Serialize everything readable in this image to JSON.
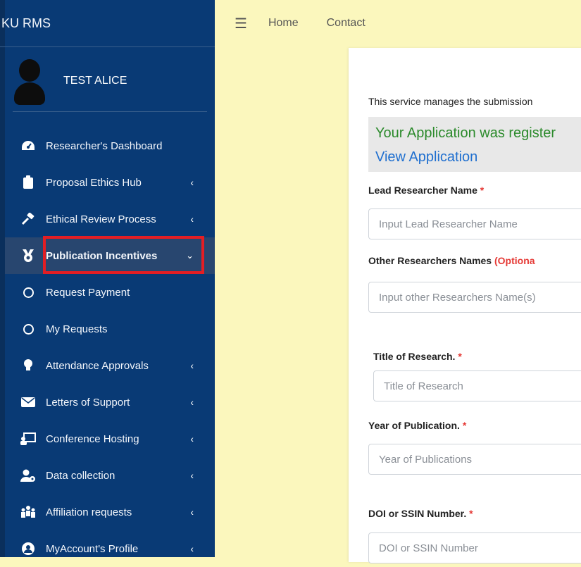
{
  "sidebar": {
    "brand": "KU RMS",
    "user_name": "TEST ALICE",
    "items": [
      {
        "label": "Researcher's Dashboard",
        "icon": "dashboard-icon",
        "chevron": ""
      },
      {
        "label": "Proposal Ethics Hub",
        "icon": "clipboard-icon",
        "chevron": "‹"
      },
      {
        "label": "Ethical Review Process",
        "icon": "gavel-icon",
        "chevron": "‹"
      },
      {
        "label": "Publication Incentives",
        "icon": "medal-icon",
        "chevron": "⌄"
      },
      {
        "label": "Request Payment",
        "icon": "circle-icon",
        "chevron": ""
      },
      {
        "label": "My Requests",
        "icon": "circle-icon",
        "chevron": ""
      },
      {
        "label": "Attendance Approvals",
        "icon": "lightbulb-icon",
        "chevron": "‹"
      },
      {
        "label": "Letters of Support",
        "icon": "envelope-icon",
        "chevron": "‹"
      },
      {
        "label": "Conference Hosting",
        "icon": "chalkboard-icon",
        "chevron": "‹"
      },
      {
        "label": "Data collection",
        "icon": "users-cog-icon",
        "chevron": "‹"
      },
      {
        "label": "Affiliation requests",
        "icon": "people-icon",
        "chevron": "‹"
      },
      {
        "label": "MyAccount's Profile",
        "icon": "user-circle-icon",
        "chevron": "‹"
      }
    ]
  },
  "topbar": {
    "menu_icon": "hamburger-icon",
    "links": [
      "Home",
      "Contact"
    ]
  },
  "form": {
    "intro": "This service manages the submission",
    "alert_message": "Your Application was register",
    "alert_link": "View Application",
    "fields": [
      {
        "label": "Lead Researcher Name",
        "required": "*",
        "optional": "",
        "placeholder": "Input Lead Researcher Name"
      },
      {
        "label": "Other Researchers Names",
        "required": "",
        "optional": "(Optiona",
        "placeholder": "Input other Researchers Name(s)"
      },
      {
        "label": "Title of Research.",
        "required": "*",
        "optional": "",
        "placeholder": "Title of Research"
      },
      {
        "label": "Year of Publication.",
        "required": "*",
        "optional": "",
        "placeholder": "Year of Publications"
      },
      {
        "label": "DOI or SSIN Number.",
        "required": "*",
        "optional": "",
        "placeholder": "DOI or SSIN Number"
      }
    ]
  },
  "colors": {
    "sidebar_bg": "#093a75",
    "content_bg": "#fbf7bd",
    "highlight": "#e31e24",
    "success_text": "#2b8a2b",
    "link_text": "#1f6fcf"
  }
}
